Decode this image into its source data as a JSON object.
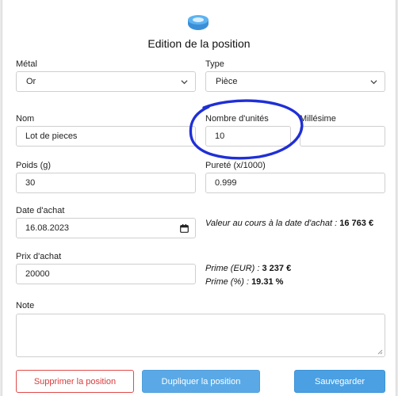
{
  "dialog": {
    "title": "Edition de la position"
  },
  "form": {
    "metal_label": "Métal",
    "metal_value": "Or",
    "type_label": "Type",
    "type_value": "Pièce",
    "name_label": "Nom",
    "name_value": "Lot de pieces",
    "units_label": "Nombre d'unités",
    "units_value": "10",
    "vintage_label": "Millésime",
    "vintage_value": "",
    "weight_label": "Poids (g)",
    "weight_value": "30",
    "purity_label": "Pureté (x/1000)",
    "purity_value": "0.999",
    "date_label": "Date d'achat",
    "date_value": "16.08.2023",
    "price_label": "Prix d'achat",
    "price_value": "20000",
    "note_label": "Note",
    "note_value": ""
  },
  "info": {
    "value_label": "Valeur au cours à la date d'achat : ",
    "value_amount": "16 763 €",
    "premium_eur_label": "Prime (EUR) : ",
    "premium_eur_value": "3 237 €",
    "premium_pct_label": "Prime (%) : ",
    "premium_pct_value": "19.31 %"
  },
  "buttons": {
    "delete": "Supprimer la position",
    "duplicate": "Dupliquer la position",
    "save": "Sauvegarder"
  },
  "colors": {
    "accent": "#4aa0e2",
    "danger": "#d83b3b",
    "annotation": "#1f2fd6"
  },
  "icons": {
    "header": "coin-stack-icon",
    "select": "chevron-down-icon",
    "date": "calendar-icon",
    "resize": "resize-handle-icon"
  }
}
